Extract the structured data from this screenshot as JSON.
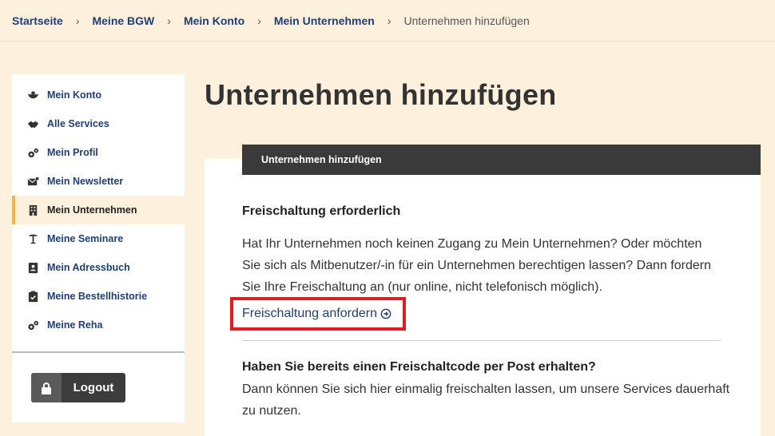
{
  "breadcrumb": {
    "items": [
      "Startseite",
      "Meine BGW",
      "Mein Konto",
      "Mein Unternehmen"
    ],
    "current": "Unternehmen hinzufügen"
  },
  "sidebar": {
    "items": [
      {
        "label": "Mein Konto",
        "icon": "account-icon"
      },
      {
        "label": "Alle Services",
        "icon": "handshake-icon"
      },
      {
        "label": "Mein Profil",
        "icon": "gears-icon"
      },
      {
        "label": "Mein Newsletter",
        "icon": "envelope-icon"
      },
      {
        "label": "Mein Unternehmen",
        "icon": "building-icon",
        "active": true
      },
      {
        "label": "Meine Seminare",
        "icon": "presentation-icon"
      },
      {
        "label": "Mein Adressbuch",
        "icon": "address-book-icon"
      },
      {
        "label": "Meine Bestellhistorie",
        "icon": "clipboard-check-icon"
      },
      {
        "label": "Meine Reha",
        "icon": "gears-icon"
      }
    ],
    "logout_label": "Logout"
  },
  "main": {
    "title": "Unternehmen hinzufügen",
    "card_header": "Unternehmen hinzufügen",
    "section1": {
      "title": "Freischaltung erforderlich",
      "text": "Hat Ihr Unternehmen noch keinen Zugang zu Mein Unternehmen? Oder möchten Sie sich als Mitbenutzer/-in für ein Unternehmen berechtigen lassen? Dann fordern Sie Ihre Freischaltung an (nur online, nicht telefonisch möglich).",
      "link_label": "Freischaltung anfordern"
    },
    "section2": {
      "title": "Haben Sie bereits einen Freischaltcode per Post erhalten?",
      "text": "Dann können Sie sich hier einmalig freischalten lassen, um unsere Services dauerhaft zu nutzen."
    }
  },
  "colors": {
    "background": "#fdf1de",
    "link": "#1f3f74",
    "header_bar": "#3a3a3a",
    "highlight": "#e21a22",
    "active_marker": "#f0b640"
  }
}
